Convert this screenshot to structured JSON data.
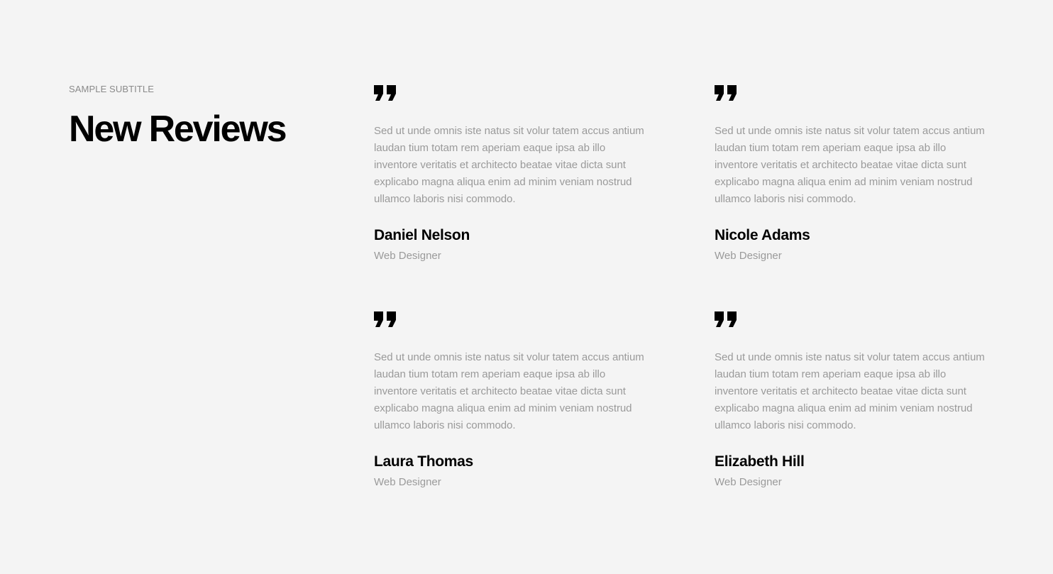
{
  "section": {
    "subtitle": "SAMPLE SUBTITLE",
    "title": "New Reviews"
  },
  "reviews": [
    {
      "icon": "quote-icon",
      "text": "Sed ut unde omnis iste natus sit volur tatem accus antium laudan tium totam rem aperiam eaque ipsa ab illo inventore veritatis et architecto beatae vitae dicta sunt explicabo magna aliqua enim ad minim veniam nostrud ullamco laboris nisi commodo.",
      "name": "Daniel Nelson",
      "role": "Web Designer"
    },
    {
      "icon": "quote-icon",
      "text": "Sed ut unde omnis iste natus sit volur tatem accus antium laudan tium totam rem aperiam eaque ipsa ab illo inventore veritatis et architecto beatae vitae dicta sunt explicabo magna aliqua enim ad minim veniam nostrud ullamco laboris nisi commodo.",
      "name": "Nicole Adams",
      "role": "Web Designer"
    },
    {
      "icon": "quote-icon",
      "text": "Sed ut unde omnis iste natus sit volur tatem accus antium laudan tium totam rem aperiam eaque ipsa ab illo inventore veritatis et architecto beatae vitae dicta sunt explicabo magna aliqua enim ad minim veniam nostrud ullamco laboris nisi commodo.",
      "name": "Laura Thomas",
      "role": "Web Designer"
    },
    {
      "icon": "quote-icon",
      "text": "Sed ut unde omnis iste natus sit volur tatem accus antium laudan tium totam rem aperiam eaque ipsa ab illo inventore veritatis et architecto beatae vitae dicta sunt explicabo magna aliqua enim ad minim veniam nostrud ullamco laboris nisi commodo.",
      "name": "Elizabeth Hill",
      "role": "Web Designer"
    }
  ],
  "colors": {
    "background": "#f4f4f4",
    "heading": "#000000",
    "muted": "#9a9a9a"
  }
}
